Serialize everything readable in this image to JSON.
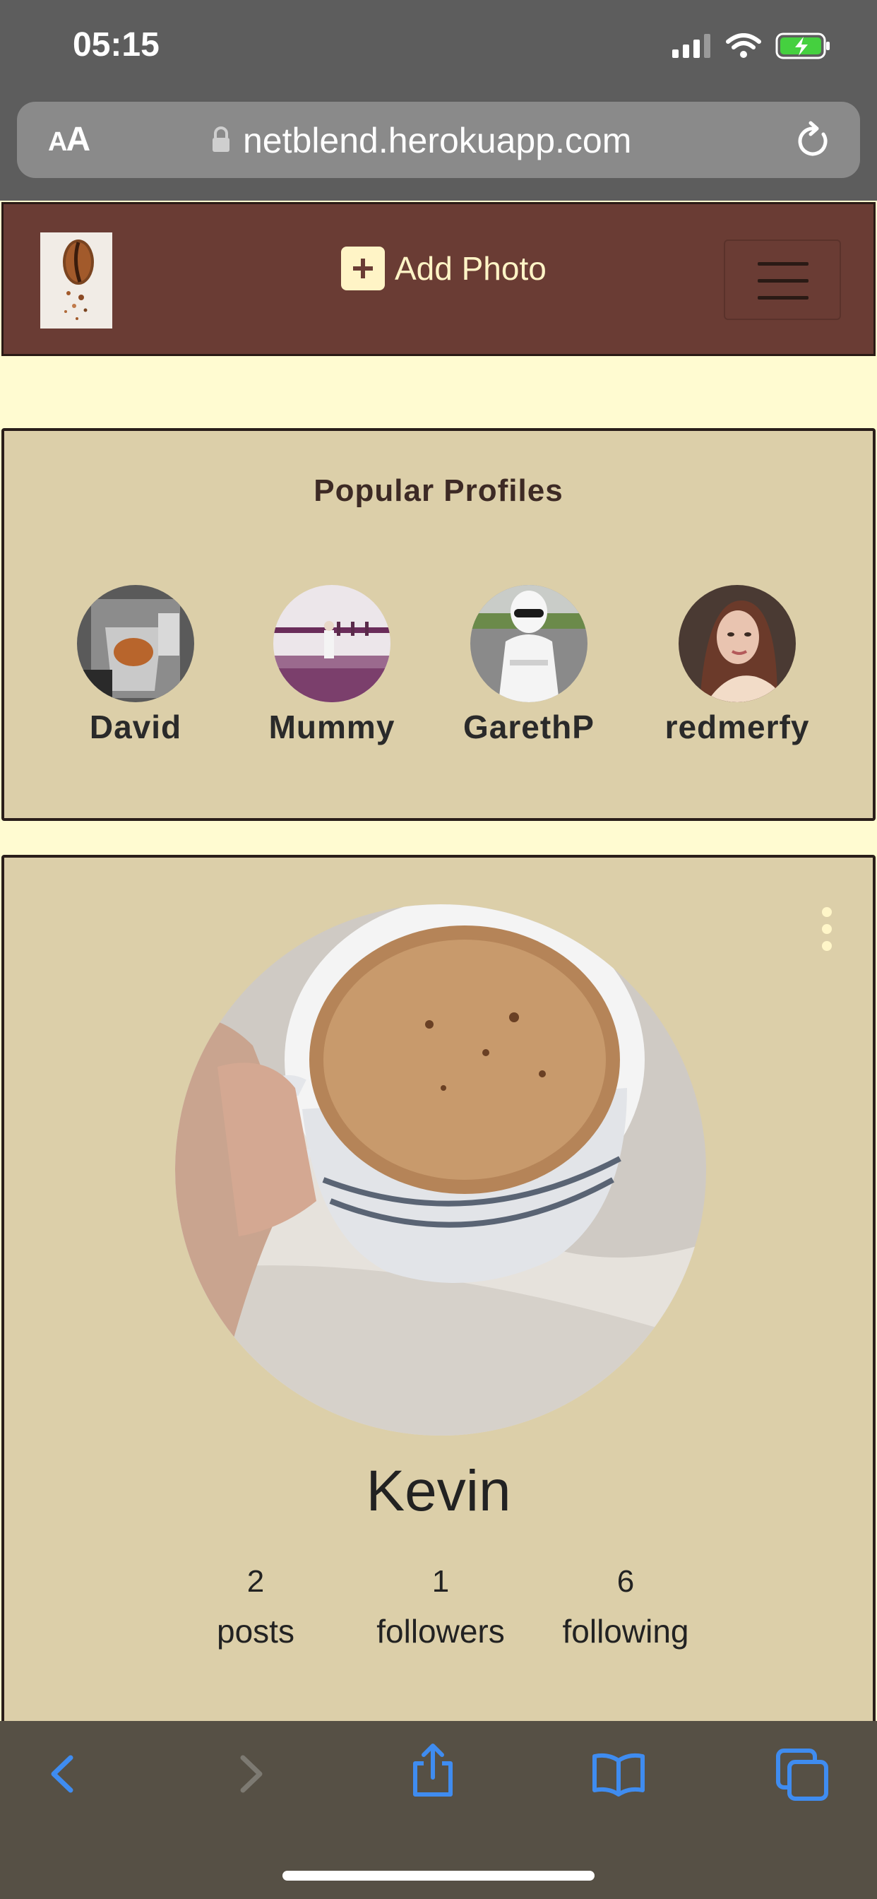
{
  "status_bar": {
    "time": "05:15",
    "icons": [
      "signal-icon",
      "wifi-icon",
      "battery-charging-icon"
    ]
  },
  "browser": {
    "text_size_label_small": "A",
    "text_size_label_large": "A",
    "url": "netblend.herokuapp.com",
    "icons": [
      "lock-icon",
      "reload-icon"
    ]
  },
  "navbar": {
    "add_photo_label": "Add Photo",
    "icons": [
      "logo-coffee-bean",
      "plus-square-icon",
      "hamburger-menu-icon"
    ],
    "colors": {
      "background": "#6a3c34",
      "text": "#fff4c6"
    }
  },
  "popular_profiles": {
    "title": "Popular Profiles",
    "profiles": [
      {
        "name": "David"
      },
      {
        "name": "Mummy"
      },
      {
        "name": "GarethP"
      },
      {
        "name": "redmerfy"
      }
    ]
  },
  "profile": {
    "username": "Kevin",
    "stats": [
      {
        "value": "2",
        "label": "posts"
      },
      {
        "value": "1",
        "label": "followers"
      },
      {
        "value": "6",
        "label": "following"
      }
    ],
    "icons": [
      "kebab-menu-icon"
    ]
  },
  "toolbar": {
    "icons": [
      "back-icon",
      "forward-icon",
      "share-icon",
      "bookmarks-icon",
      "tabs-icon"
    ]
  },
  "colors": {
    "page_background": "#fffbd1",
    "card_background": "#dccfa9",
    "browser_chrome": "#5d5d5d",
    "toolbar_accent": "#3f8cf0"
  }
}
